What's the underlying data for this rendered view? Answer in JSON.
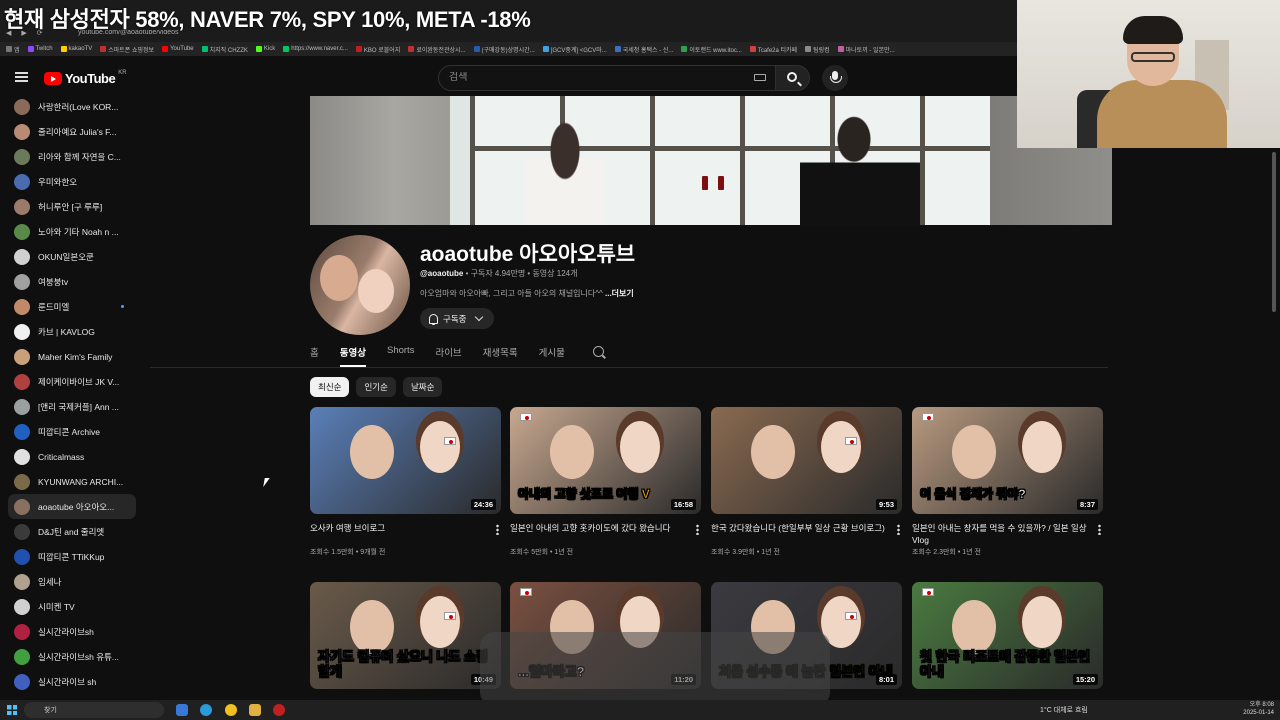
{
  "stream_title": "현재 삼성전자 58%, NAVER 7%, SPY 10%, META -18%",
  "browser": {
    "url": "youtube.com/@aoaotube/videos",
    "bookmarks": [
      "앱",
      "Twitch",
      "kakaoTV",
      "스마트폰 쇼핑정보",
      "YouTube",
      "치지직 CHZZK",
      "Kick",
      "https://www.naver.c...",
      "KBO 로블어지",
      "료이완동전관상시...",
      "(구매강동)상명시간...",
      "[GCV중계] <GCV마...",
      "국세청 홈택스 - 신...",
      "이토랜드 www.itoc...",
      "Tcafe2a 티카페",
      "팀링컴",
      "마나토끼 - 일본만..."
    ]
  },
  "header": {
    "logo": "YouTube",
    "logo_region": "KR",
    "search_placeholder": "검색"
  },
  "sidebar": {
    "subscriptions": [
      {
        "label": "사랑한러(Love KOR...",
        "color": "#8a6b5a"
      },
      {
        "label": "줄리아예요 Julia's F...",
        "color": "#b98b74"
      },
      {
        "label": "리아와 함께 자연을 C...",
        "color": "#6a7a5a"
      },
      {
        "label": "우미와한오",
        "color": "#4b6bb0"
      },
      {
        "label": "허니루안 [구 루루]",
        "color": "#9a7b6a"
      },
      {
        "label": "노아와 기타 Noah n ...",
        "color": "#5a8a4a"
      },
      {
        "label": "OKUN일본오쿤",
        "color": "#d0d0d0"
      },
      {
        "label": "여붕붕tv",
        "color": "#a0a0a0"
      },
      {
        "label": "룬드미엘",
        "color": "#c08a6a",
        "dot": true
      },
      {
        "label": "카브 | KAVLOG",
        "color": "#f0f0f0"
      },
      {
        "label": "Maher Kim's Family",
        "color": "#caa07a"
      },
      {
        "label": "제이케이바이브 JK V...",
        "color": "#b04040"
      },
      {
        "label": "[앤리 국제커플] Ann ...",
        "color": "#9aa0a0"
      },
      {
        "label": "띠깝티콘 Archive",
        "color": "#2060c0"
      },
      {
        "label": "Criticalmass",
        "color": "#e0e0e0"
      },
      {
        "label": "KYUNWANG ARCHI...",
        "color": "#7a6a4a"
      },
      {
        "label": "aoaotube 아오아오...",
        "color": "#8a7060",
        "active": true
      },
      {
        "label": "D&J틴 and 줄리엣",
        "color": "#3a3a3a"
      },
      {
        "label": "띠깝티콘 TTiKKup",
        "color": "#2050b0"
      },
      {
        "label": "임세나",
        "color": "#b0a090"
      },
      {
        "label": "시미켄 TV",
        "color": "#d0d0d0"
      },
      {
        "label": "실시간라이브sh",
        "color": "#b02040"
      },
      {
        "label": "실시간라이브sh 유튜...",
        "color": "#40a040"
      },
      {
        "label": "실시간라이브 sh",
        "color": "#4060c0"
      }
    ]
  },
  "channel": {
    "name": "aoaotube 아오아오튜브",
    "handle": "@aoaotube",
    "meta": " • 구독자 4.94만명 • 동영상 124개",
    "description": "아오엄마와 아오아빠, 그리고 아들 아오의 채널입니다^^ ",
    "more": "...더보기",
    "subscribe_label": "구독중",
    "tabs": [
      "홈",
      "동영상",
      "Shorts",
      "라이브",
      "재생목록",
      "게시물"
    ],
    "active_tab": 1,
    "chips": [
      "최신순",
      "인기순",
      "날짜순"
    ]
  },
  "videos": [
    {
      "title": "오사카 여행 브이로그",
      "meta": "조회수 1.5만회 • 9개월 전",
      "duration": "24:36",
      "bg": "#5a7fb8",
      "caption": ""
    },
    {
      "title": "일본인 아내의 고향 홋카이도에 갔다 왔습니다",
      "meta": "조회수 5만회 • 1년 전",
      "duration": "16:58",
      "bg": "#c8a890",
      "caption": "아내의 고향 삿포로 여행 V"
    },
    {
      "title": "한국 갔다왔습니다 (한일부부 일상 근황 브이로그)",
      "meta": "조회수 3.9만회 • 1년 전",
      "duration": "9:53",
      "bg": "#8a6a50",
      "caption": ""
    },
    {
      "title": "일본인 아내는 창자를 먹을 수 있을까? / 일본 일상 Vlog",
      "meta": "조회수 2.3만회 • 1년 전",
      "duration": "8:37",
      "bg": "#b89a80",
      "caption": "이 음식 정체가 뭐야?"
    },
    {
      "title": "",
      "meta": "",
      "duration": "10:49",
      "bg": "#6a5a4a",
      "caption": "자기도 컴퓨터 샀으니 나도 쇼핑할게"
    },
    {
      "title": "",
      "meta": "",
      "duration": "11:20",
      "bg": "#7a5040",
      "caption": "...얼마라고?"
    },
    {
      "title": "",
      "meta": "",
      "duration": "8:01",
      "bg": "#3a3a40",
      "caption": "처음 성수동 에 놀란 일본인 아내"
    },
    {
      "title": "",
      "meta": "",
      "duration": "15:20",
      "bg": "#4a7a40",
      "caption": "첫 한국 리조트에 감동한 일본인 아내"
    }
  ],
  "taskbar": {
    "search_label": "찾기",
    "weather": "1°C  대체로 흐림",
    "time": "오후 8:08",
    "date": "2025-01-14"
  }
}
